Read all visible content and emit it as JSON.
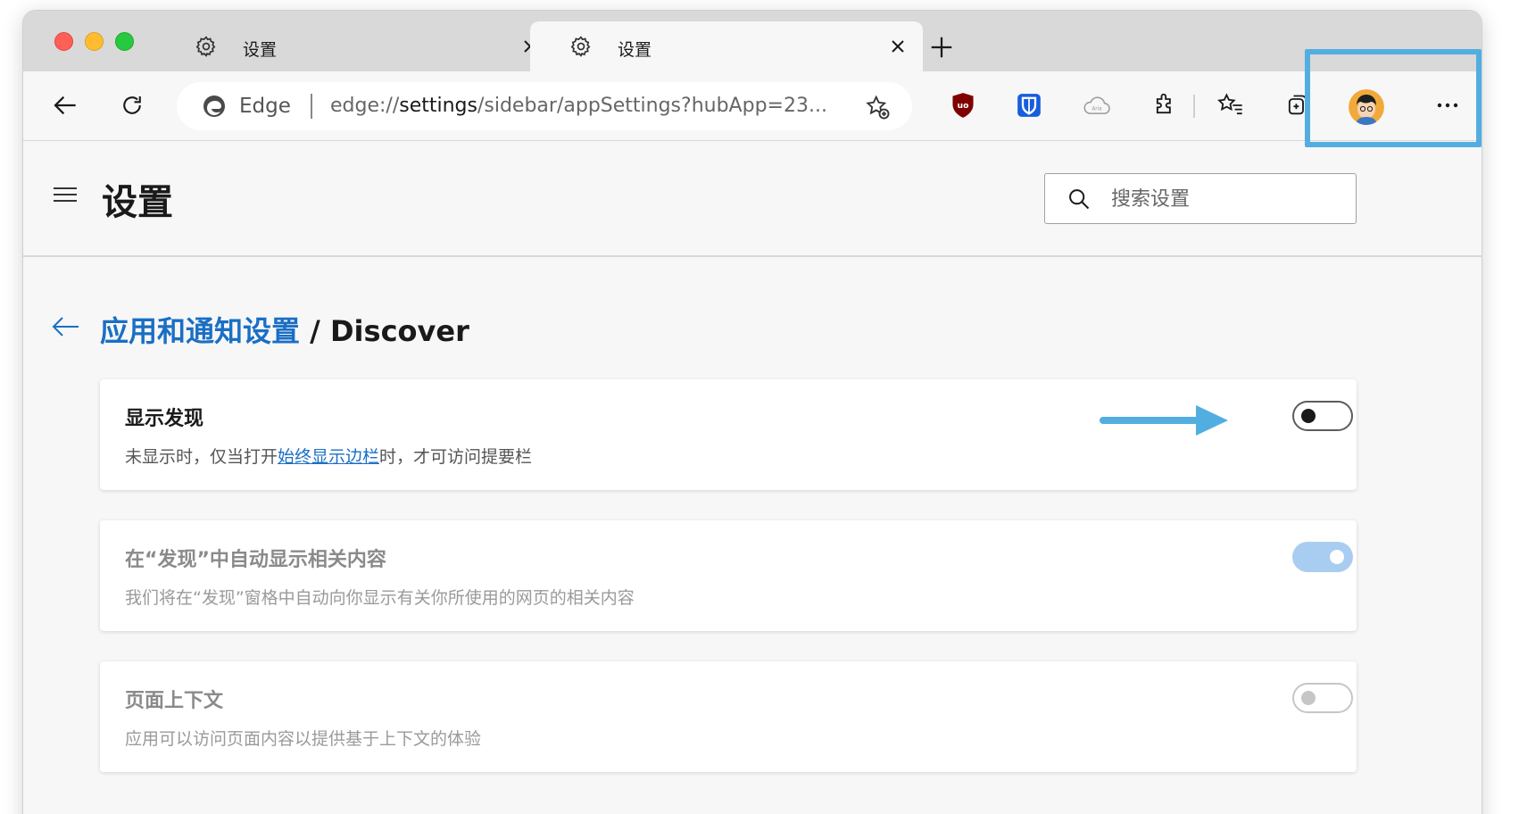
{
  "tabs": [
    {
      "title": "设置",
      "icon": "gear-icon"
    },
    {
      "title": "设置",
      "icon": "gear-icon"
    }
  ],
  "address_bar": {
    "browser_label": "Edge",
    "url_prefix": "edge://",
    "url_host": "settings",
    "url_path": "/sidebar/appSettings?hubApp=23..."
  },
  "extensions": [
    "ublock-origin-icon",
    "bitwarden-icon",
    "aria-cloud-icon",
    "extensions-puzzle-icon",
    "favorites-icon",
    "collections-icon"
  ],
  "settings": {
    "title": "设置",
    "search_placeholder": "搜索设置"
  },
  "breadcrumb": {
    "parent": "应用和通知设置",
    "separator": " / ",
    "current": "Discover"
  },
  "cards": [
    {
      "title": "显示发现",
      "desc_before": "未显示时，仅当打开",
      "desc_link": "始终显示边栏",
      "desc_after": "时，才可访问提要栏",
      "toggle": "off"
    },
    {
      "title": "在“发现”中自动显示相关内容",
      "desc": "我们将在“发现”窗格中自动向你显示有关你所使用的网页的相关内容",
      "toggle": "on-disabled"
    },
    {
      "title": "页面上下文",
      "desc": "应用可以访问页面内容以提供基于上下文的体验",
      "toggle": "off-disabled"
    }
  ],
  "colors": {
    "accent": "#1a6fc4",
    "highlight_box": "#52aee0",
    "annotation_arrow": "#52aee0",
    "toggle_disabled_on": "#a9cdf0"
  }
}
